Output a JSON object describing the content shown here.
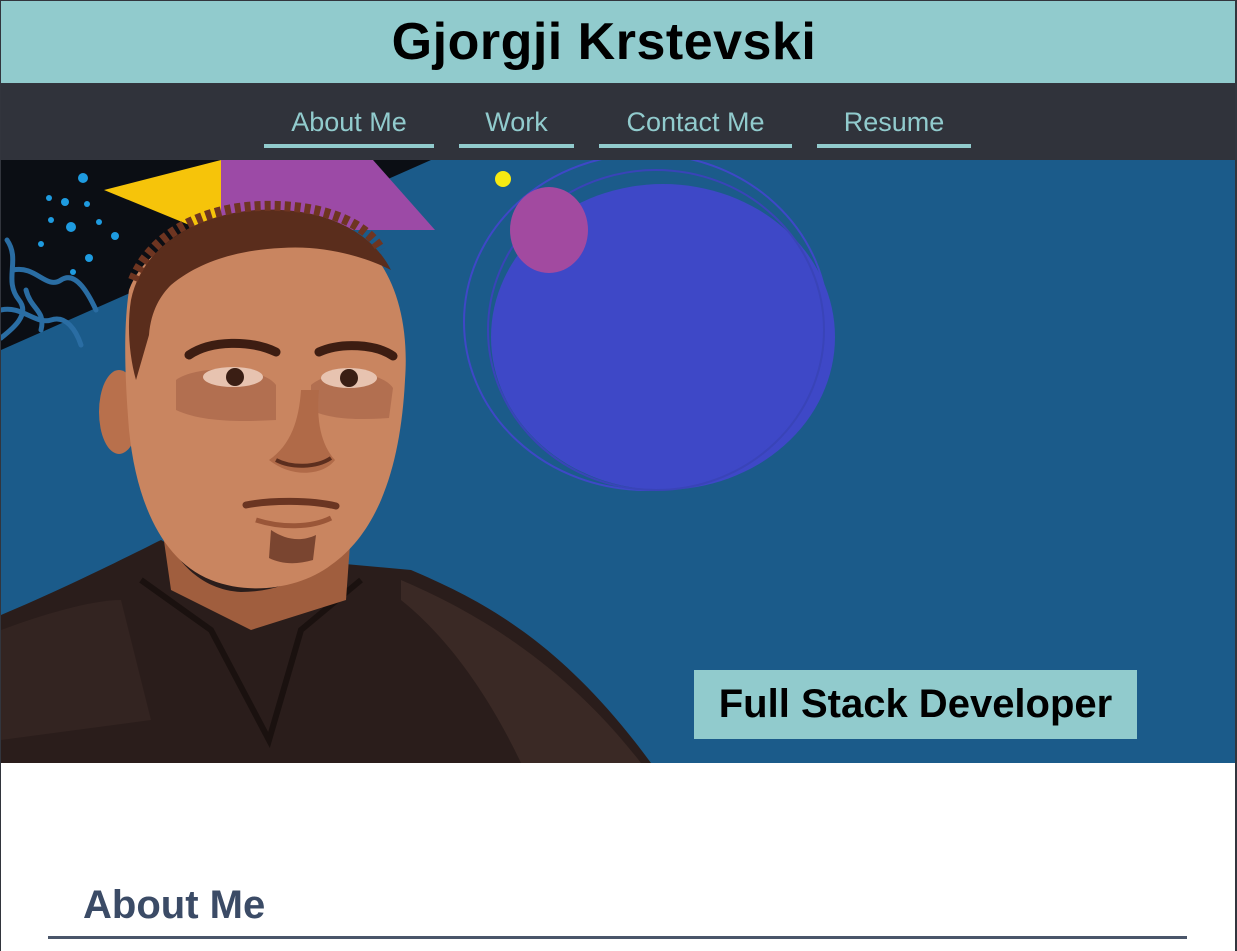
{
  "header": {
    "title": "Gjorgji Krstevski"
  },
  "nav": {
    "items": [
      {
        "label": "About Me"
      },
      {
        "label": "Work"
      },
      {
        "label": "Contact Me"
      },
      {
        "label": "Resume"
      }
    ]
  },
  "hero": {
    "tagline": "Full Stack Developer"
  },
  "about": {
    "heading": "About Me"
  },
  "colors": {
    "header_bg": "#91cbcd",
    "nav_bg": "#30333b",
    "nav_text": "#91cbcd",
    "hero_bg": "#1b5b8a",
    "heading_text": "#3b4b66"
  }
}
